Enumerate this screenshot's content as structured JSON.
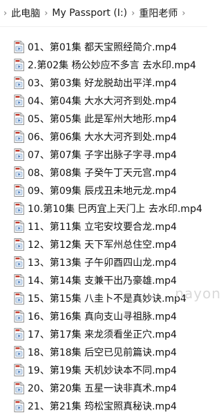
{
  "breadcrumb": {
    "items": [
      "此电脑",
      "My Passport (I:)",
      "重阳老师"
    ],
    "separator": "›"
  },
  "files": [
    {
      "name": "01、第01集 都天宝照经简介.mp4",
      "icon": "video-file-icon"
    },
    {
      "name": "2.第02集 杨公妙应不多言 去水印.mp4",
      "icon": "video-file-icon"
    },
    {
      "name": "03、第03集 好龙脱劫出平洋.mp4",
      "icon": "video-file-icon"
    },
    {
      "name": "04、第04集 大水大河齐到处.mp4",
      "icon": "video-file-icon"
    },
    {
      "name": "05、第05集 此是军州大地形.mp4",
      "icon": "video-file-icon"
    },
    {
      "name": "06、第06集 大水大河齐到处.mp4",
      "icon": "video-file-icon"
    },
    {
      "name": "07、第07集 子字出脉子字寻.mp4",
      "icon": "video-file-icon"
    },
    {
      "name": "08、第08集 子癸午丁天元宫.mp4",
      "icon": "video-file-icon"
    },
    {
      "name": "09、第09集 辰戌丑未地元龙.mp4",
      "icon": "video-file-icon"
    },
    {
      "name": "10.第10集 巳丙宜上天门上 去水印.mp4",
      "icon": "video-file-icon"
    },
    {
      "name": "11、第11集 立宅安坟要合龙.mp4",
      "icon": "video-file-icon"
    },
    {
      "name": "12、第12集 天下军州总住空.mp4",
      "icon": "video-file-icon"
    },
    {
      "name": "13、第13集 子午卯酉四山龙.mp4",
      "icon": "video-file-icon"
    },
    {
      "name": "14、第14集 支兼干出乃豪雄.mp4",
      "icon": "video-file-icon"
    },
    {
      "name": "15、第15集 八圭卜不是真妙诀.mp4",
      "icon": "video-file-icon"
    },
    {
      "name": "16、第16集 真向支山寻祖脉.mp4",
      "icon": "video-file-icon"
    },
    {
      "name": "17、第17集 来龙须看坐正穴.mp4",
      "icon": "video-file-icon"
    },
    {
      "name": "18、第18集 后空已见前篇诀.mp4",
      "icon": "video-file-icon"
    },
    {
      "name": "19、第19集 天机妙诀本不同.mp4",
      "icon": "video-file-icon"
    },
    {
      "name": "20、第20集 五星一诀非真术.mp4",
      "icon": "video-file-icon"
    },
    {
      "name": "21、第21集 筠松宝照真秘诀.mp4",
      "icon": "video-file-icon"
    }
  ],
  "watermark": "nayon"
}
